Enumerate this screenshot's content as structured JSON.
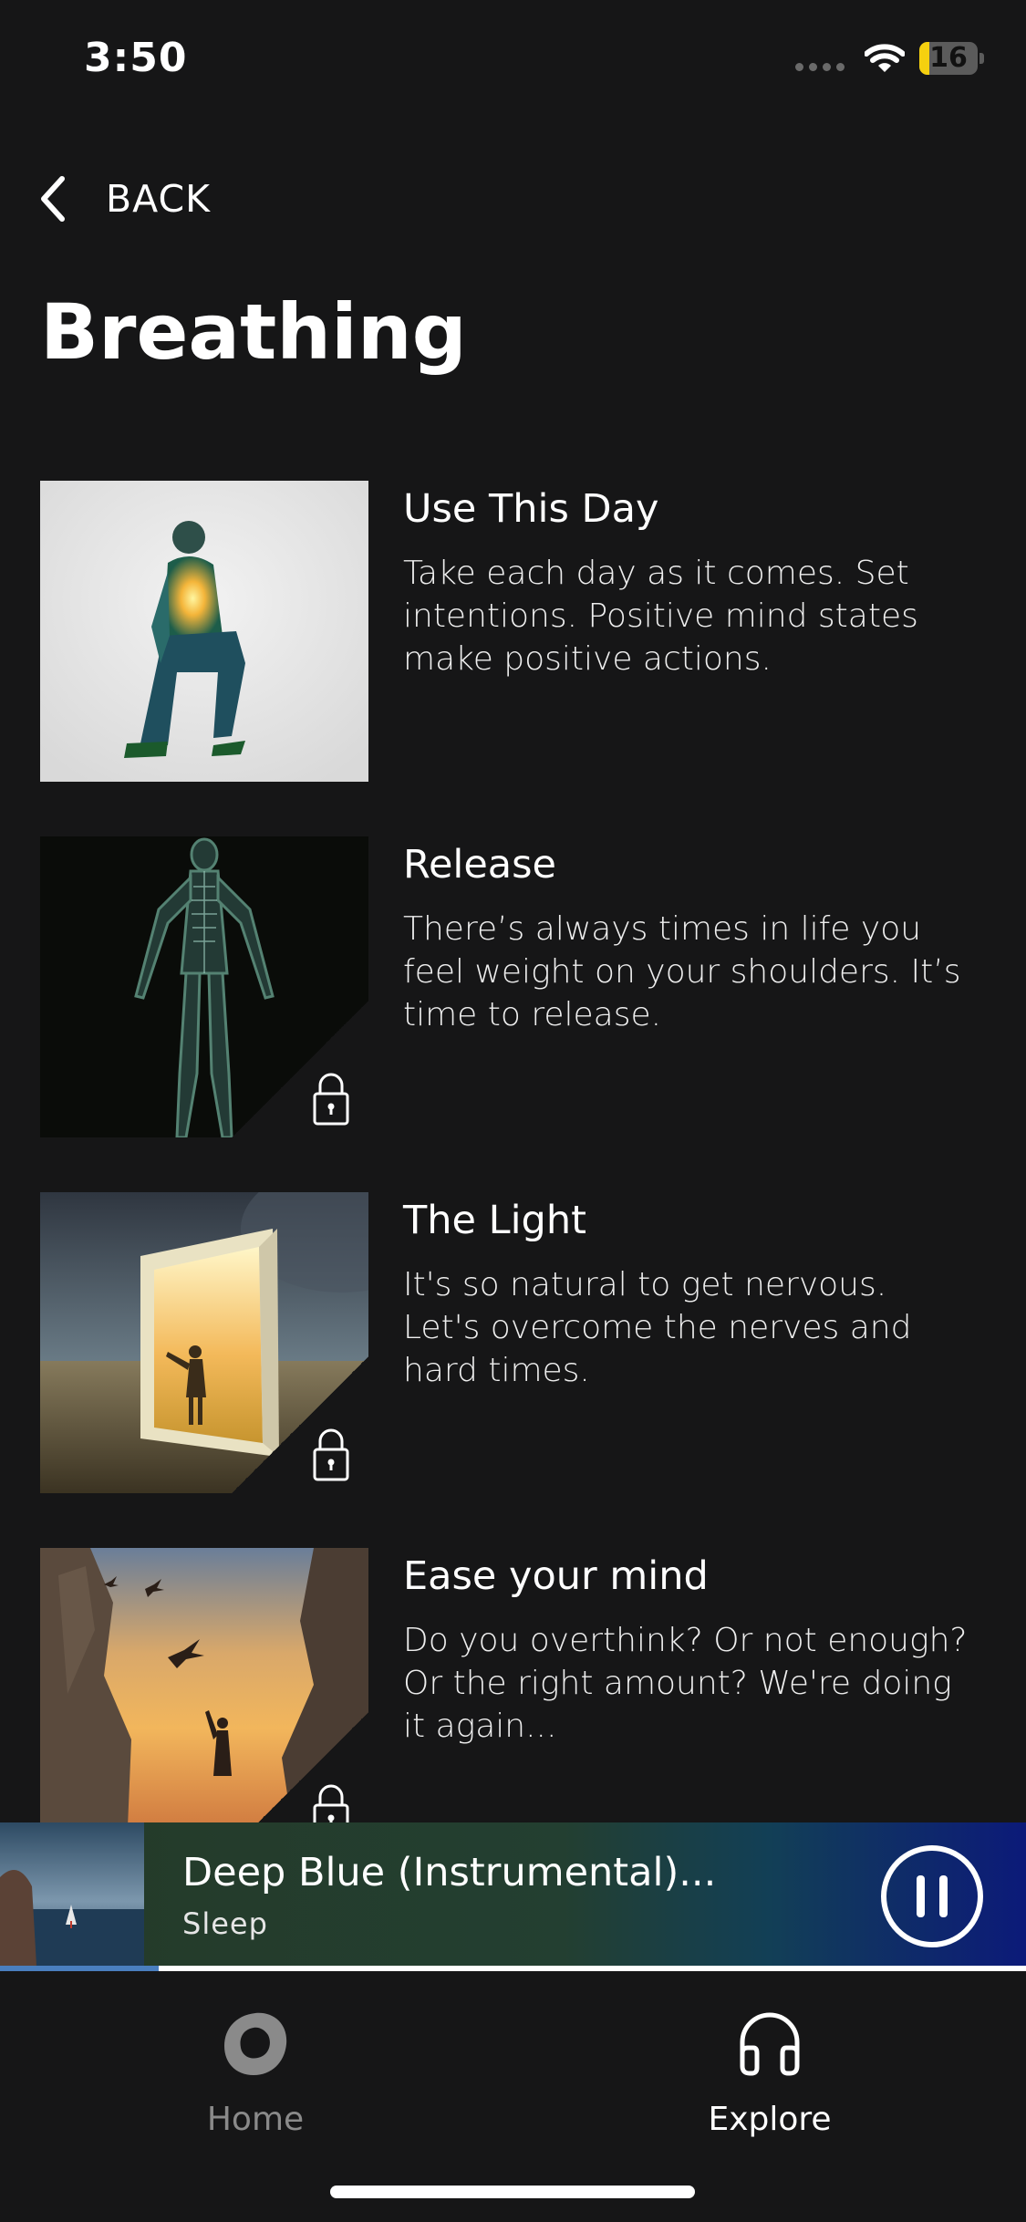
{
  "status_bar": {
    "time": "3:50",
    "battery_level": "16",
    "battery_color": "#f5d00f",
    "wifi_icon": "wifi-icon",
    "signal_icon": "cellular-signal-icon"
  },
  "header": {
    "back_label": "BACK",
    "back_icon": "chevron-left-icon",
    "title": "Breathing"
  },
  "items": [
    {
      "title": "Use This Day",
      "description": "Take each day as it comes. Set intentions. Positive mind states make positive actions.",
      "locked": false
    },
    {
      "title": "Release",
      "description": "There’s always times in life you feel weight on your shoulders. It’s time to release.",
      "locked": true
    },
    {
      "title": "The Light",
      "description": "It's so natural to get nervous. Let's overcome the nerves and hard times.",
      "locked": true
    },
    {
      "title": "Ease your mind",
      "description": "Do you overthink? Or not enough? Or the right amount? We're doing it again...",
      "locked": true
    }
  ],
  "now_playing": {
    "title": "Deep Blue (Instrumental)...",
    "subtitle": "Sleep",
    "progress": 0.155,
    "pause_icon": "pause-icon",
    "progress_color": "#4a7fbf"
  },
  "tab_bar": {
    "home_label": "Home",
    "home_icon": "home-blob-icon",
    "explore_label": "Explore",
    "explore_icon": "headphones-icon",
    "active_tab": "Explore"
  },
  "colors": {
    "background": "#161617",
    "text": "#ffffff",
    "inactive_tab": "#8a8a8a"
  }
}
